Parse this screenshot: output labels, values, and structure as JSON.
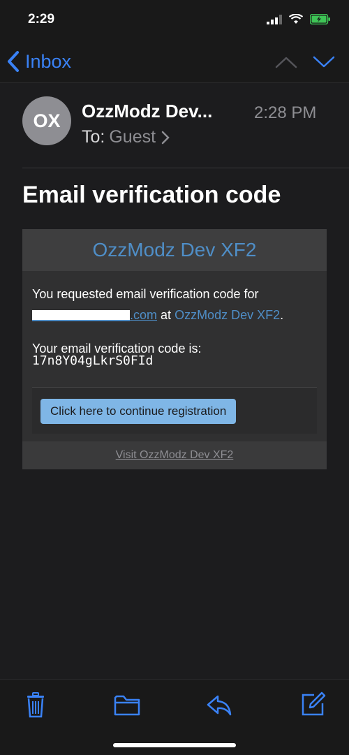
{
  "status_bar": {
    "time": "2:29",
    "icons": [
      "signal-icon",
      "wifi-icon",
      "battery-icon"
    ]
  },
  "nav": {
    "back_label": "Inbox",
    "icons": [
      "chevron-left-icon",
      "chevron-up-icon",
      "chevron-down-icon"
    ],
    "accent_color": "#3a82f6"
  },
  "header": {
    "avatar_initials": "OX",
    "sender": "OzzModz Dev...",
    "time": "2:28 PM",
    "to_label": "To:",
    "to_value": "Guest"
  },
  "email": {
    "subject": "Email verification code",
    "card_title": "OzzModz Dev XF2",
    "line1": "You requested email verification code for",
    "email_suffix": ".com",
    "at_text": "at",
    "site_link": "OzzModz Dev XF2",
    "period": ".",
    "code_intro": "Your email verification code is:",
    "code": "17n8Y04gLkrS0FId",
    "button_label": "Click here to continue registration",
    "footer_link": "Visit OzzModz Dev XF2",
    "link_color": "#4f8ec7"
  },
  "toolbar": {
    "icons": [
      "trash-icon",
      "folder-icon",
      "reply-icon",
      "compose-icon"
    ]
  }
}
